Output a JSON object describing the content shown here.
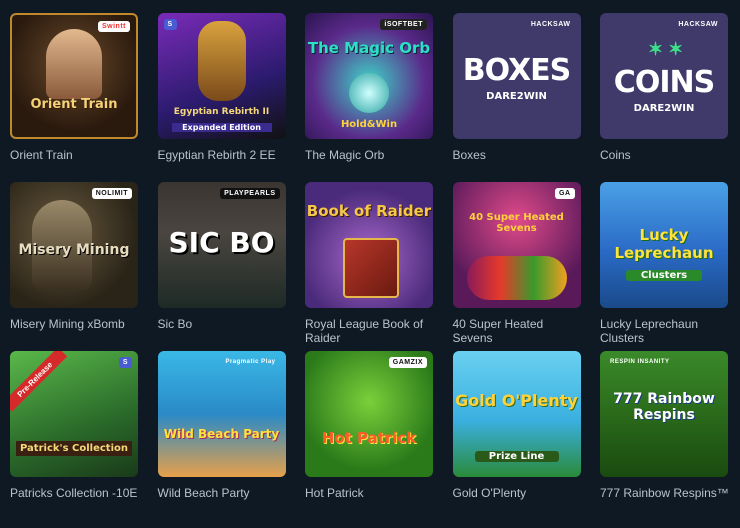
{
  "games": [
    {
      "title": "Orient Train",
      "art": "Orient Train",
      "badge": "Swintt"
    },
    {
      "title": "Egyptian Rebirth 2 EE",
      "art": "Egyptian Rebirth II",
      "art2": "Expanded Edition",
      "badge": "S"
    },
    {
      "title": "The Magic Orb",
      "art": "The Magic Orb",
      "art2": "Hold&Win",
      "badge": "iSOFTBET"
    },
    {
      "title": "Boxes",
      "art": "BOXES",
      "art2": "DARE2WIN",
      "badge": "HACKSAW"
    },
    {
      "title": "Coins",
      "art": "COINS",
      "art2": "DARE2WIN",
      "badge": "HACKSAW"
    },
    {
      "title": "Misery Mining xBomb",
      "art": "Misery Mining",
      "badge": "NOLIMIT"
    },
    {
      "title": "Sic Bo",
      "art": "SIC BO",
      "badge": "PLAYPEARLS"
    },
    {
      "title": "Royal League Book of Raider",
      "art": "Book of Raider",
      "badge": ""
    },
    {
      "title": "40 Super Heated Sevens",
      "art": "40 Super Heated Sevens",
      "badge": "GA"
    },
    {
      "title": "Lucky Leprechaun Clusters",
      "art": "Lucky Leprechaun",
      "art2": "Clusters",
      "badge": ""
    },
    {
      "title": "Patricks Collection -10E",
      "art": "Patrick's Collection",
      "art2": "Pre-Release",
      "badge": "S"
    },
    {
      "title": "Wild Beach Party",
      "art": "Wild Beach Party",
      "badge": "Pragmatic Play"
    },
    {
      "title": "Hot Patrick",
      "art": "Hot Patrick",
      "badge": "GAMZIX"
    },
    {
      "title": "Gold O'Plenty",
      "art": "Gold O'Plenty",
      "art2": "Prize Line",
      "badge": ""
    },
    {
      "title": "777 Rainbow Respins™",
      "art": "777 Rainbow Respins",
      "badge": "RESPIN INSANITY"
    }
  ]
}
